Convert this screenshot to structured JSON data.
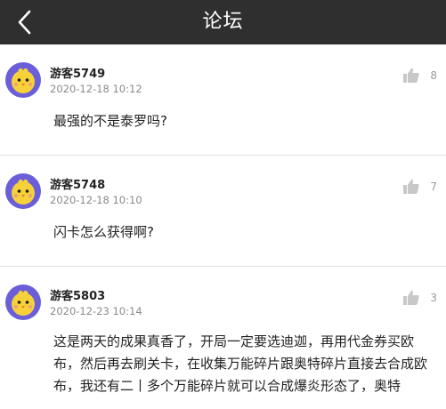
{
  "header": {
    "title": "论坛",
    "back_icon": "chevron-left-icon"
  },
  "posts": [
    {
      "username": "游客5749",
      "time": "2020-12-18 10:12",
      "likes": "8",
      "content": "最强的不是泰罗吗?"
    },
    {
      "username": "游客5748",
      "time": "2020-12-18 10:10",
      "likes": "7",
      "content": "闪卡怎么获得啊?"
    },
    {
      "username": "游客5803",
      "time": "2020-12-23 10:14",
      "likes": "3",
      "content": "这是两天的成果真香了，开局一定要选迪迦，再用代金券买欧布，然后再去刷关卡，在收集万能碎片跟奥特碎片直接去合成欧布，我还有二丨多个万能碎片就可以合成爆炎形态了，奥特"
    }
  ],
  "colors": {
    "header_bg": "#2f2f2f",
    "avatar_bg": "#6b5fd9",
    "page_bg": "#f4f4f4"
  }
}
